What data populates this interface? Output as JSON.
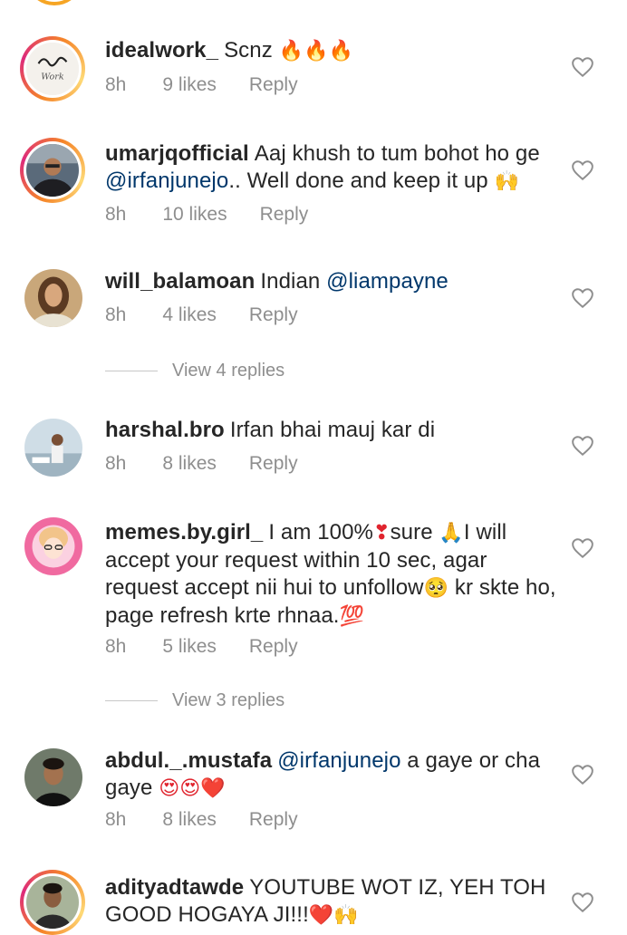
{
  "colors": {
    "mention": "#00376b",
    "meta": "#8e8e8e",
    "ring_gradient": [
      "#f58529",
      "#dd2a7b",
      "#feda77"
    ],
    "flame": "#ff7a1a",
    "red_heart": "#e0242e"
  },
  "comments": [
    {
      "username": "idealwork_",
      "text_before": "Scnz ",
      "emoji": "🔥🔥🔥",
      "time": "8h",
      "likes": "9 likes",
      "reply": "Reply",
      "avatar_text": "Work"
    },
    {
      "username": "umarjqofficial",
      "text_before": "Aaj khush to tum bohot ho ge",
      "mention": "@irfanjunejo",
      "text_after": ".. Well done and keep it up ",
      "emoji": "🙌",
      "time": "8h",
      "likes": "10 likes",
      "reply": "Reply"
    },
    {
      "username": "will_balamoan",
      "text_before": "Indian ",
      "mention": "@liampayne",
      "time": "8h",
      "likes": "4 likes",
      "reply": "Reply",
      "view_replies": "View 4 replies"
    },
    {
      "username": "harshal.bro",
      "text_before": "Irfan bhai mauj kar di",
      "time": "8h",
      "likes": "8 likes",
      "reply": "Reply"
    },
    {
      "username": "memes.by.girl_",
      "text_before": "I am 100%",
      "emoji1": "❣",
      "text_mid1": "sure ",
      "emoji2": "🙏",
      "text_mid2": "I will accept your request within 10 sec, agar request accept nii hui to unfollow",
      "emoji3": "🥺",
      "text_mid3": " kr skte ho, page refresh krte rhnaa.",
      "emoji4": "💯",
      "time": "8h",
      "likes": "5 likes",
      "reply": "Reply",
      "view_replies": "View 3 replies"
    },
    {
      "username": "abdul._.mustafa",
      "mention": "@irfanjunejo",
      "text_after": " a gaye or cha gaye ",
      "emoji": "😍😍❤️",
      "time": "8h",
      "likes": "8 likes",
      "reply": "Reply"
    },
    {
      "username": "adityadtawde",
      "text_before": "YOUTUBE WOT IZ, YEH TOH GOOD HOGAYA JI!!!",
      "emoji": "❤️🙌"
    }
  ]
}
